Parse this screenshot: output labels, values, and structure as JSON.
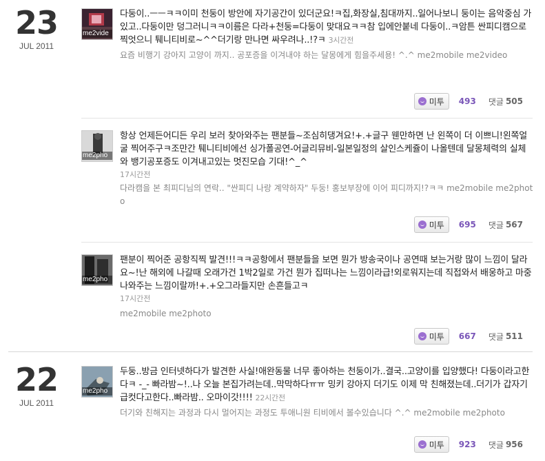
{
  "days": [
    {
      "day": "23",
      "month_year": "JUL 2011",
      "posts": [
        {
          "thumb_label": "me2vide",
          "text": "다둥이..ㅡㅡㅋㅋ이미 천둥이 방안에 자기공간이 있더군요!ㅋ집,화장실,침대까지..일어나보니 둥이는 음악중심 가있고..다둥이만 덩그러니ㅋㅋ이름은 다라+천둥=다둥이 맞대요ㅋㅋ참 입에안붙네 다둥이..ㅋ암튼 싼피디캠으로 찍엇으니 퉤니티비로~^^더기랑 만나면 싸우려나..!?ㅋ",
          "time": "3시간전",
          "meta": "요즘 비행기 강아지 고양이 까지.. 공포증을 이겨내야 하는 달몽에게 힘을주세용! ^.^",
          "source": "me2mobile me2video",
          "metoo_label": "미투",
          "metoo_count": "493",
          "comment_label": "댓글",
          "comment_count": "505"
        },
        {
          "thumb_label": "me2pho",
          "text": "항상 언제든어디든 우리 보러 찾아와주는 팬분들~조심히댕겨요!+.+글구 웬만하면 난 왼쪽이 더 이쁘니!왼쪽얼굴 찍어주구ㅋ조만간 퉤니티비에선 싱가폴공연-어글리뮤비-일본일정의 살인스케쥴이 나올텐데 달몽체력의 실체와 뱅기공포증도 이겨내고있는 멋진모습 기대!^_^",
          "time": "17시간전",
          "meta": "다라캠을 본 최피디님의 연락.. \"싼피디 나랑 계약하자\" 두둥! 홍보부장에 이어 피디까지!?ㅋㅋ",
          "source": "me2mobile me2photo",
          "metoo_label": "미투",
          "metoo_count": "695",
          "comment_label": "댓글",
          "comment_count": "567"
        },
        {
          "thumb_label": "me2pho",
          "text": "팬분이 찍어준 공항직찍 발견!!!ㅋㅋ공항에서 팬분들을 보면 뭔가 방송국이나 공연때 보는거랑 많이 느낌이 달라요~!난 해외에 나갈때 오래가건 1박2일로 가건 뭔가 집떠나는 느낌이라급!외로워지는데 직접와서 배웅하고 마중 나와주는 느낌이랄까!+.+오그라들지만 손흔들고ㅋ",
          "time": "17시간전",
          "meta": "",
          "source": "me2mobile me2photo",
          "metoo_label": "미투",
          "metoo_count": "667",
          "comment_label": "댓글",
          "comment_count": "511"
        }
      ]
    },
    {
      "day": "22",
      "month_year": "JUL 2011",
      "posts": [
        {
          "thumb_label": "me2pho",
          "text": "두둥..방금 인터넷하다가 발견한 사실!애완동물 너무 좋아하는 천둥이가..결국..고양이를 입양했다! 다둥이라고한다ㅋ -_- 빠라밤~!..나 오늘 본집가려는데..막막하다ㅠㅠ 밍키 강아지 더기도 이제 막 친해졌는데..더기가 갑자기 급컷다고한다..빠라밤.. 오마이갓!!!!",
          "time": "22시간전",
          "meta": "더기와 친해지는 과정과 다시 멀어지는 과정도 투애니원 티비에서 볼수있습니다 ^.^",
          "source": "me2mobile me2photo",
          "metoo_label": "미투",
          "metoo_count": "923",
          "comment_label": "댓글",
          "comment_count": "956"
        }
      ]
    }
  ],
  "colors": {
    "metoo_count": "#7a56b8",
    "metoo_icon": "#9b6fd0",
    "divider": "#e3e3e3"
  }
}
